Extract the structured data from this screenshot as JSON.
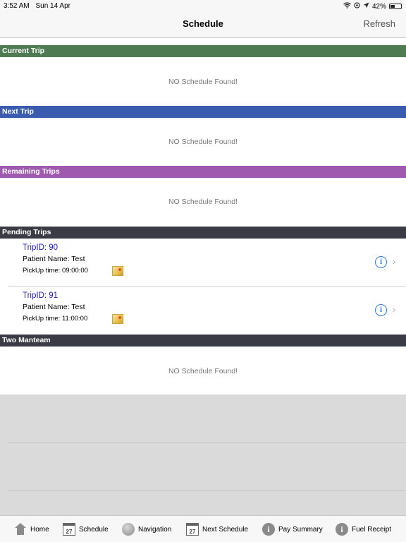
{
  "status_bar": {
    "time": "3:52 AM",
    "date": "Sun 14 Apr",
    "battery": "42%"
  },
  "nav": {
    "title": "Schedule",
    "refresh_label": "Refresh"
  },
  "colors": {
    "current": "#4e7b52",
    "next": "#3a5bae",
    "remaining": "#9f59ae",
    "pending": "#3b3b45",
    "two_manteam": "#3b3b45",
    "trip_id": "#1a1acc",
    "info_accent": "#2f7de1"
  },
  "sections": {
    "current": {
      "label": "Current Trip",
      "empty": "NO Schedule Found!"
    },
    "next": {
      "label": "Next Trip",
      "empty": "NO Schedule Found!"
    },
    "remaining": {
      "label": "Remaining Trips",
      "empty": "NO Schedule Found!"
    },
    "pending": {
      "label": "Pending Trips",
      "trips": [
        {
          "trip_id": "TripID: 90",
          "patient": "Patient Name: Test",
          "pickup": "PickUp time: 09:00:00"
        },
        {
          "trip_id": "TripID: 91",
          "patient": "Patient Name: Test",
          "pickup": "PickUp time: 11:00:00"
        }
      ]
    },
    "two_manteam": {
      "label": "Two Manteam",
      "empty": "NO Schedule Found!"
    }
  },
  "tabs": [
    {
      "label": "Home",
      "icon": "home-icon"
    },
    {
      "label": "Schedule",
      "icon": "calendar-icon",
      "icon_text": "27"
    },
    {
      "label": "Navigation",
      "icon": "globe-icon"
    },
    {
      "label": "Next Schedule",
      "icon": "calendar-icon",
      "icon_text": "27"
    },
    {
      "label": "Pay Summary",
      "icon": "info-icon",
      "icon_text": "i"
    },
    {
      "label": "Fuel Receipt",
      "icon": "info-icon",
      "icon_text": "i"
    }
  ]
}
